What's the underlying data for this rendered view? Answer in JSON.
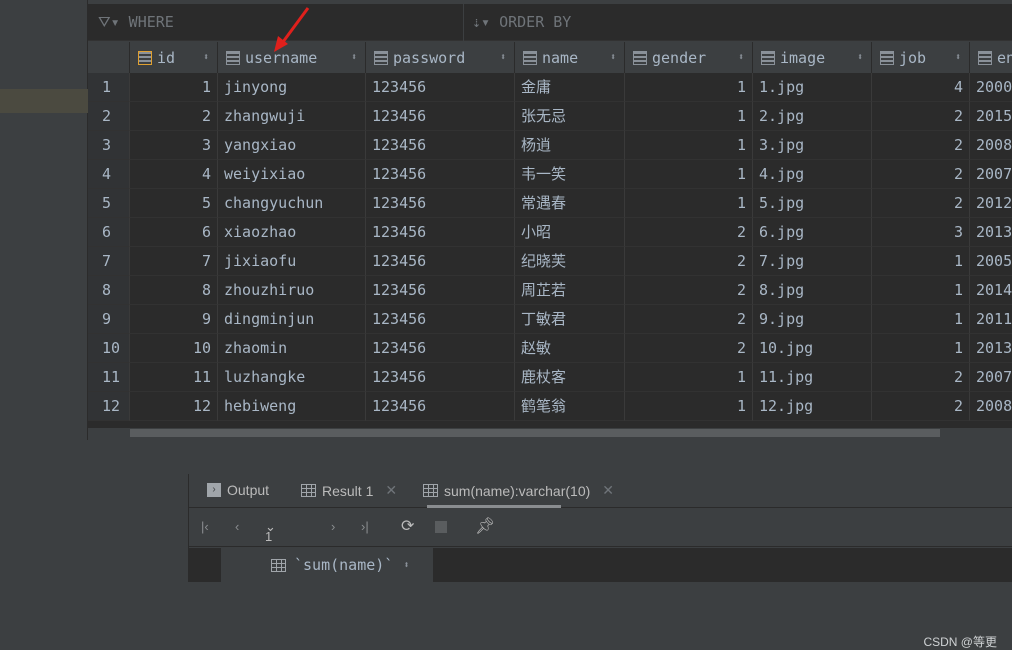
{
  "filter": {
    "where_label": "WHERE",
    "order_label": "ORDER BY"
  },
  "columns": [
    "id",
    "username",
    "password",
    "name",
    "gender",
    "image",
    "job",
    "en"
  ],
  "rows": [
    [
      "1",
      "1",
      "jinyong",
      "123456",
      "金庸",
      "1",
      "1.jpg",
      "4",
      "2000"
    ],
    [
      "2",
      "2",
      "zhangwuji",
      "123456",
      "张无忌",
      "1",
      "2.jpg",
      "2",
      "2015"
    ],
    [
      "3",
      "3",
      "yangxiao",
      "123456",
      "杨逍",
      "1",
      "3.jpg",
      "2",
      "2008"
    ],
    [
      "4",
      "4",
      "weiyixiao",
      "123456",
      "韦一笑",
      "1",
      "4.jpg",
      "2",
      "2007"
    ],
    [
      "5",
      "5",
      "changyuchun",
      "123456",
      "常遇春",
      "1",
      "5.jpg",
      "2",
      "2012"
    ],
    [
      "6",
      "6",
      "xiaozhao",
      "123456",
      "小昭",
      "2",
      "6.jpg",
      "3",
      "2013"
    ],
    [
      "7",
      "7",
      "jixiaofu",
      "123456",
      "纪晓芙",
      "2",
      "7.jpg",
      "1",
      "2005"
    ],
    [
      "8",
      "8",
      "zhouzhiruo",
      "123456",
      "周芷若",
      "2",
      "8.jpg",
      "1",
      "2014"
    ],
    [
      "9",
      "9",
      "dingminjun",
      "123456",
      "丁敏君",
      "2",
      "9.jpg",
      "1",
      "2011"
    ],
    [
      "10",
      "10",
      "zhaomin",
      "123456",
      "赵敏",
      "2",
      "10.jpg",
      "1",
      "2013"
    ],
    [
      "11",
      "11",
      "luzhangke",
      "123456",
      "鹿杖客",
      "1",
      "11.jpg",
      "2",
      "2007"
    ],
    [
      "12",
      "12",
      "hebiweng",
      "123456",
      "鹤笔翁",
      "1",
      "12.jpg",
      "2",
      "2008"
    ]
  ],
  "tabs": [
    {
      "label": "Output"
    },
    {
      "label": "Result 1"
    },
    {
      "label": "sum(name):varchar(10)",
      "active": true
    }
  ],
  "toolbar": {
    "rows_label": "1 row"
  },
  "result": {
    "column": "`sum(name)`"
  },
  "watermark": "CSDN @等更",
  "colors": {
    "annotation_arrow": "#e0201c",
    "key_icon": "#e0a030"
  }
}
